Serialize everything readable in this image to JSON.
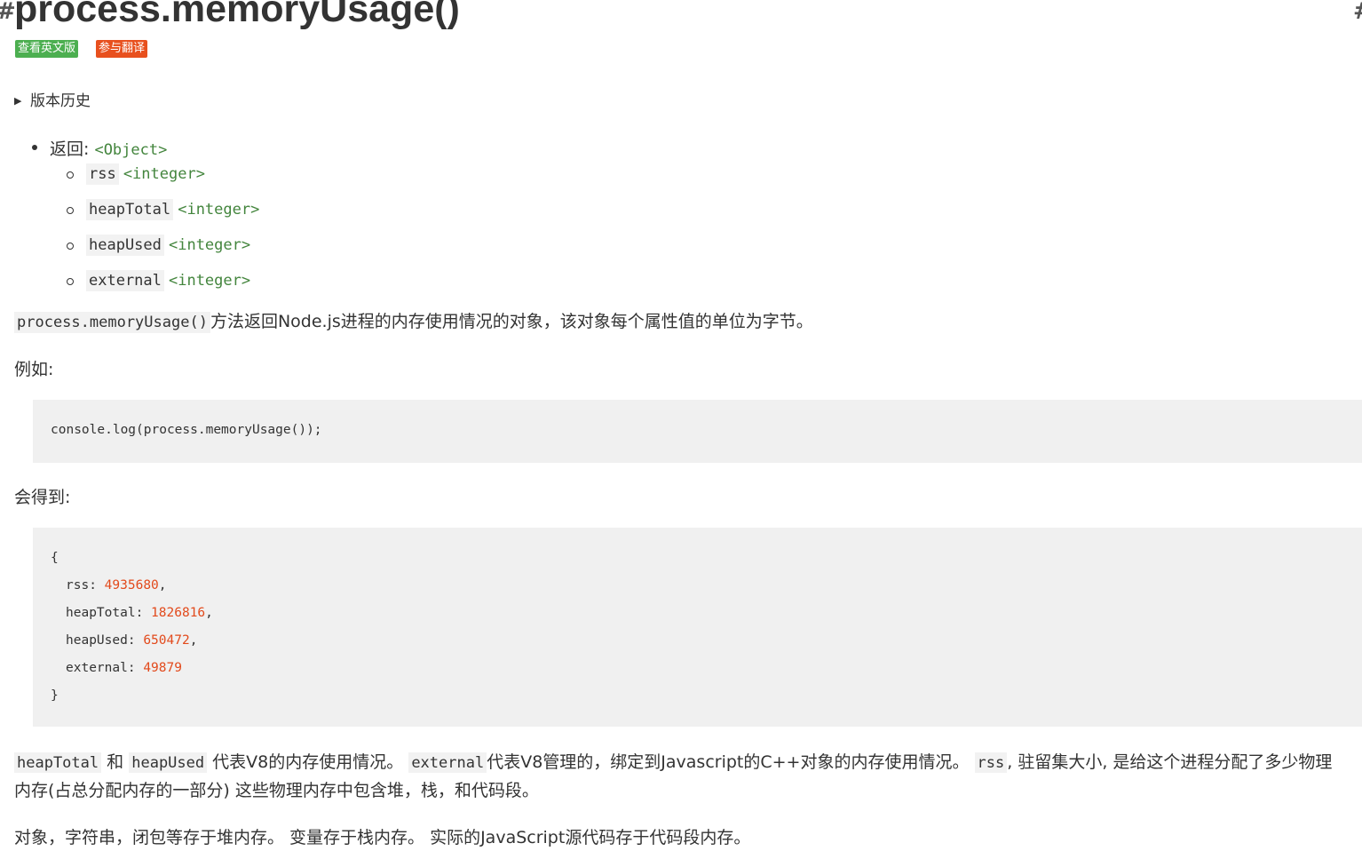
{
  "heading": {
    "title": "process.memoryUsage()"
  },
  "badges": {
    "english": "查看英文版",
    "translate": "参与翻译"
  },
  "history": {
    "label": "版本历史"
  },
  "returns": {
    "label": "返回:",
    "type": "<Object>",
    "properties": [
      {
        "name": "rss",
        "type": "<integer>"
      },
      {
        "name": "heapTotal",
        "type": "<integer>"
      },
      {
        "name": "heapUsed",
        "type": "<integer>"
      },
      {
        "name": "external",
        "type": "<integer>"
      }
    ]
  },
  "description": {
    "code": "process.memoryUsage()",
    "text": "方法返回Node.js进程的内存使用情况的对象，该对象每个属性值的单位为字节。"
  },
  "example_label": "例如:",
  "example_code": "console.log(process.memoryUsage());",
  "result_label": "会得到:",
  "result": {
    "open": "{",
    "rows": [
      {
        "key": "rss",
        "value": "4935680",
        "suffix": ","
      },
      {
        "key": "heapTotal",
        "value": "1826816",
        "suffix": ","
      },
      {
        "key": "heapUsed",
        "value": "650472",
        "suffix": ","
      },
      {
        "key": "external",
        "value": "49879",
        "suffix": ""
      }
    ],
    "close": "}"
  },
  "explanation": {
    "code1": "heapTotal",
    "and": "和",
    "code2": "heapUsed",
    "text1": "代表V8的内存使用情况。",
    "code3": "external",
    "text2": "代表V8管理的，绑定到Javascript的C++对象的内存使用情况。",
    "code4": "rss",
    "text3": ", 驻留集大小, 是给这个进程分配了多少物理",
    "line2": "内存(占总分配内存的一部分) 这些物理内存中包含堆，栈，和代码段。"
  },
  "final_note": "对象，字符串，闭包等存于堆内存。 变量存于栈内存。 实际的JavaScript源代码存于代码段内存。",
  "colors": {
    "type_link": "#43853d",
    "number": "#e24a1c",
    "badge_en": "#4caf50",
    "badge_tr": "#e8501e",
    "code_bg": "#f0f0f0"
  }
}
